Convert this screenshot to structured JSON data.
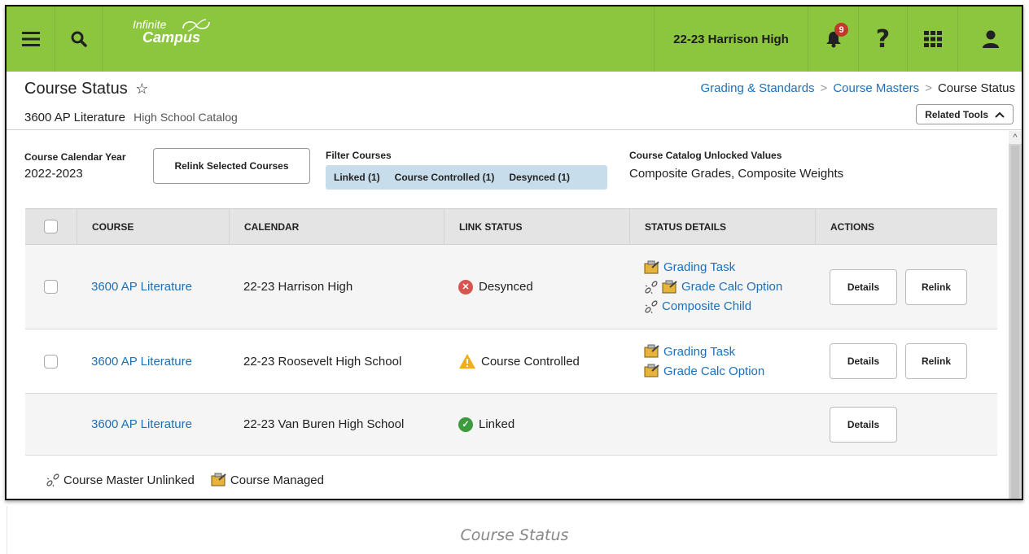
{
  "topbar": {
    "logo_line1": "Infinite",
    "logo_line2": "Campus",
    "school": "22-23 Harrison High",
    "notification_count": "9"
  },
  "header": {
    "title": "Course Status",
    "course_name": "3600 AP Literature",
    "catalog": "High School Catalog",
    "breadcrumb": [
      "Grading & Standards",
      "Course Masters",
      "Course Status"
    ],
    "related_tools_label": "Related Tools"
  },
  "controls": {
    "calendar_year_label": "Course Calendar Year",
    "calendar_year_value": "2022-2023",
    "relink_selected_label": "Relink Selected Courses",
    "filter_label": "Filter Courses",
    "filter_linked": "Linked (1)",
    "filter_controlled": "Course Controlled (1)",
    "filter_desynced": "Desynced (1)",
    "unlocked_label": "Course Catalog Unlocked Values",
    "unlocked_value": "Composite Grades, Composite Weights"
  },
  "table": {
    "headers": [
      "COURSE",
      "CALENDAR",
      "LINK STATUS",
      "STATUS DETAILS",
      "ACTIONS"
    ],
    "rows": [
      {
        "course": "3600 AP Literature",
        "calendar": "22-23 Harrison High",
        "status": "Desynced",
        "details": [
          "Grading Task",
          "Grade Calc Option",
          "Composite Child"
        ],
        "details_label": "Details",
        "relink_label": "Relink"
      },
      {
        "course": "3600 AP Literature",
        "calendar": "22-23 Roosevelt High School",
        "status": "Course Controlled",
        "details": [
          "Grading Task",
          "Grade Calc Option"
        ],
        "details_label": "Details",
        "relink_label": "Relink"
      },
      {
        "course": "3600 AP Literature",
        "calendar": "22-23 Van Buren High School",
        "status": "Linked",
        "details": [],
        "details_label": "Details"
      }
    ]
  },
  "legend": {
    "unlinked": "Course Master Unlinked",
    "managed": "Course Managed"
  },
  "caption": "Course Status",
  "colors": {
    "topbar": "#8cc63f",
    "link": "#1d70b8",
    "desynced": "#d9534f",
    "controlled": "#f0ad1c",
    "linked": "#3c9b3c",
    "filter_pill": "#c8ddec"
  }
}
